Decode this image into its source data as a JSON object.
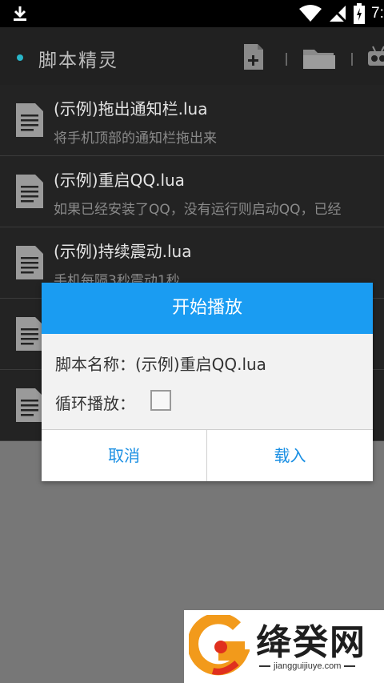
{
  "status_bar": {
    "time": "7:",
    "icons": [
      "download-icon",
      "wifi-icon",
      "signal-icon",
      "battery-icon"
    ]
  },
  "toolbar": {
    "title": "脚本精灵",
    "icons": [
      "new-file-icon",
      "folder-icon",
      "robot-icon"
    ]
  },
  "list": {
    "items": [
      {
        "title": "(示例)拖出通知栏.lua",
        "desc": "将手机顶部的通知栏拖出来"
      },
      {
        "title": "(示例)重启QQ.lua",
        "desc": "如果已经安装了QQ，没有运行则启动QQ，已经"
      },
      {
        "title": "(示例)持续震动.lua",
        "desc": "手机每隔3秒震动1秒"
      },
      {
        "title": "",
        "desc": ""
      },
      {
        "title": "",
        "desc": ""
      }
    ]
  },
  "dialog": {
    "title": "开始播放",
    "script_name_label": "脚本名称：(示例)重启QQ.lua",
    "loop_label": "循环播放：",
    "loop_checked": false,
    "cancel_label": "取消",
    "load_label": "载入"
  },
  "watermark": {
    "name": "绛癸网",
    "url": "jiangguijiuye.com"
  },
  "colors": {
    "accent": "#1a9cf2",
    "button_text": "#1a8fe3",
    "toolbar_bg": "#212121",
    "list_bg": "#232323",
    "dot": "#29b6c9"
  }
}
